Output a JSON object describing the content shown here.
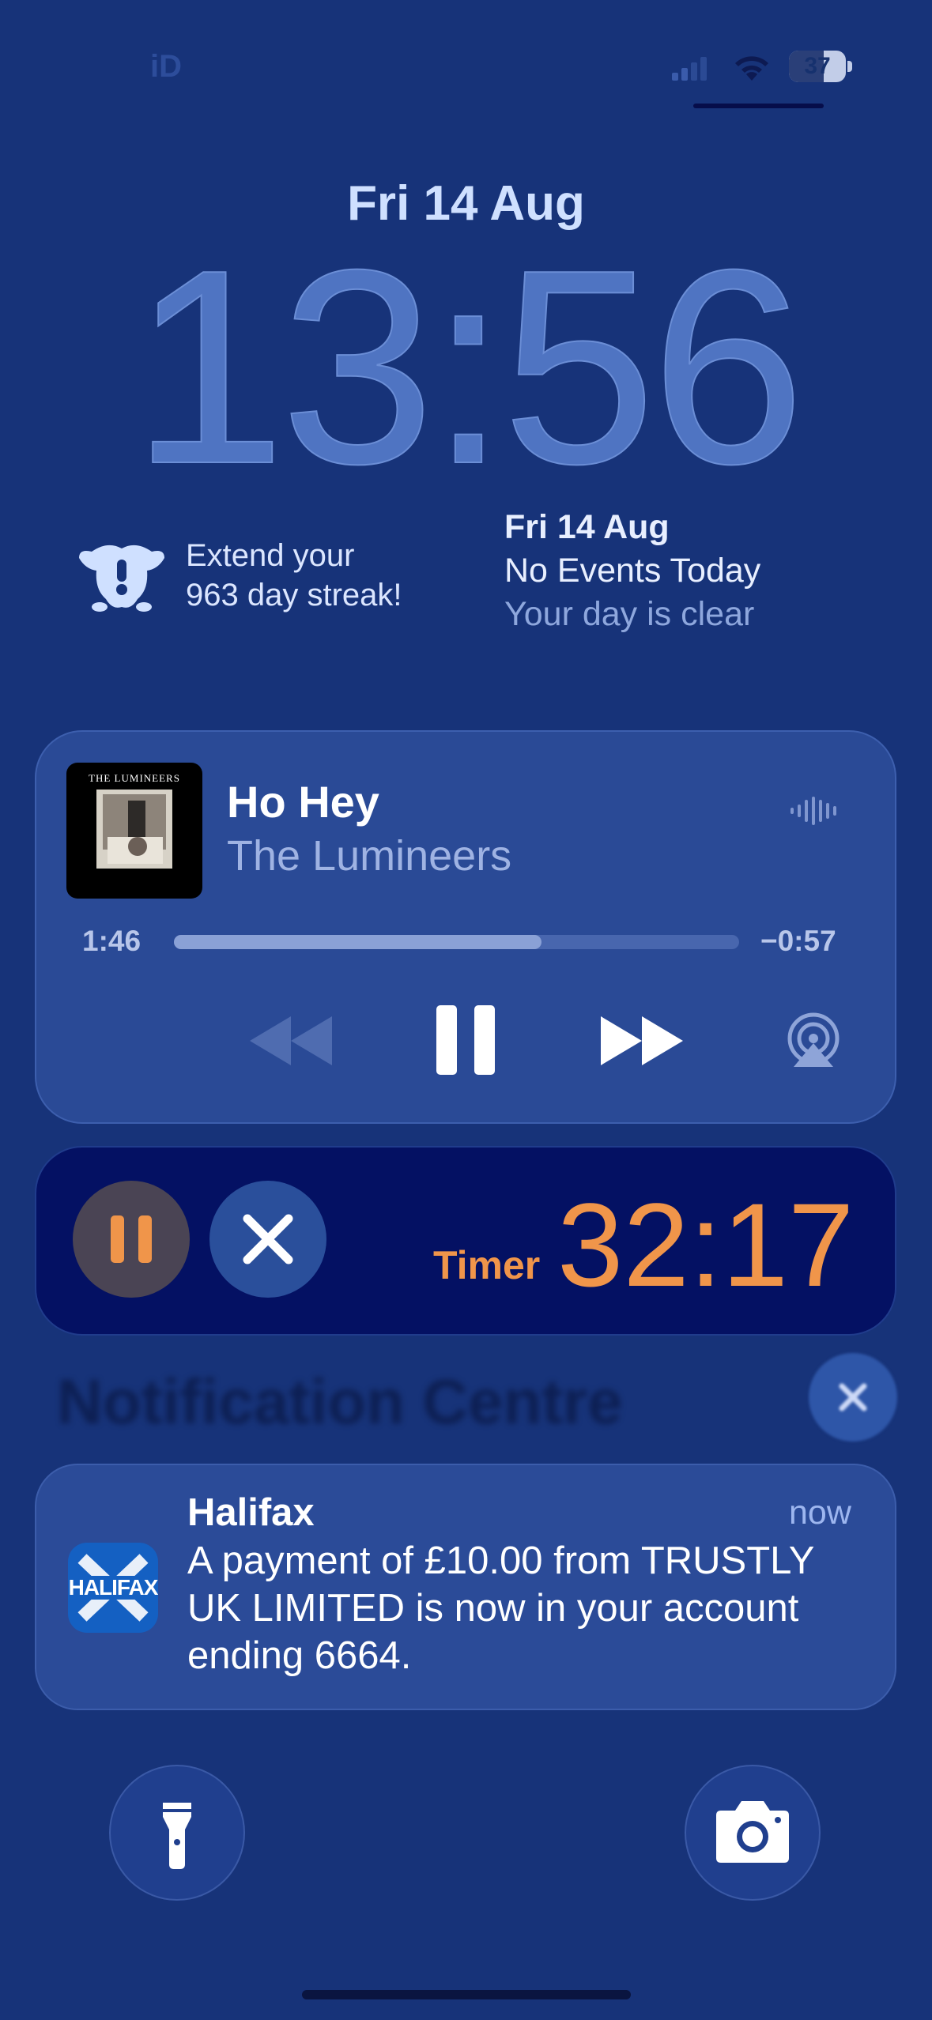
{
  "status_bar": {
    "carrier_text": "iD",
    "battery": "37",
    "battery_level": 0.37
  },
  "lock": {
    "date": "Fri 14 Aug",
    "time": "13:56"
  },
  "widgets": {
    "streak": {
      "line1": "Extend your",
      "line2": "963 day streak!"
    },
    "calendar": {
      "date": "Fri 14 Aug",
      "events": "No Events Today",
      "note": "Your day is clear"
    }
  },
  "now_playing": {
    "song": "Ho Hey",
    "artist": "The Lumineers",
    "album_art_title": "THE LUMINEERS",
    "elapsed": "1:46",
    "remaining": "−0:57",
    "progress": 0.65
  },
  "timer": {
    "label": "Timer",
    "value": "32:17"
  },
  "notification_centre": {
    "title": "Notification Centre"
  },
  "notification": {
    "app": "Halifax",
    "icon_text": "HALIFAX",
    "time": "now",
    "body": "A payment of £10.00 from TRUSTLY UK LIMITED is now in your account ending 6664."
  },
  "colors": {
    "background": "#173379",
    "accent_orange": "#f0954a",
    "card": "#2a4a96"
  },
  "icons": [
    "signal-icon",
    "wifi-icon",
    "battery-icon",
    "streak-mascot-icon",
    "waveform-icon",
    "rewind-icon",
    "pause-icon",
    "fast-forward-icon",
    "airplay-icon",
    "timer-pause-icon",
    "close-icon",
    "flashlight-icon",
    "camera-icon"
  ]
}
